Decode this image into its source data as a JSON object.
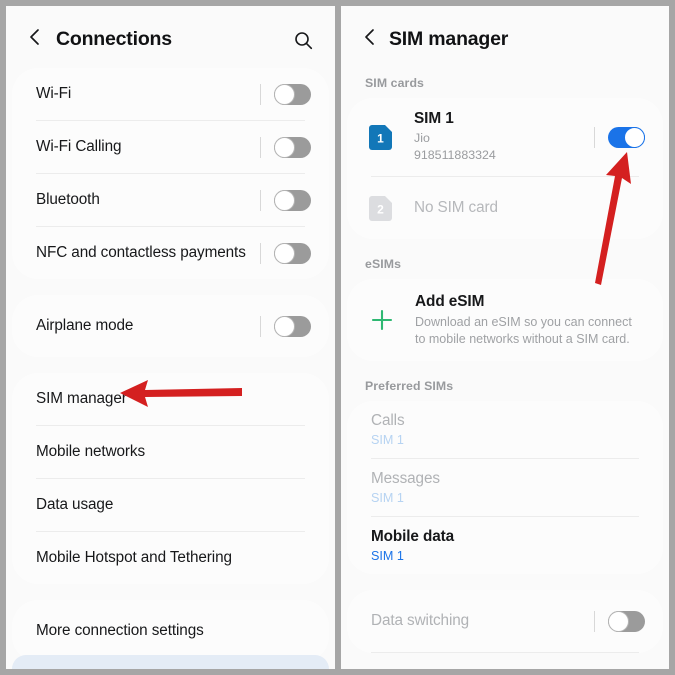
{
  "theme": {
    "accent_blue": "#1a73e8",
    "accent_green": "#2eb872",
    "annotation_red": "#d42020",
    "page_bg": "#fafafa",
    "card_bg": "#fcfcfc",
    "gutter_gray": "#a6a6a6"
  },
  "left_panel": {
    "header": {
      "back_icon": "chevron-left-icon",
      "title": "Connections",
      "search_icon": "search-icon"
    },
    "group_1": [
      {
        "label": "Wi-Fi",
        "toggle": "off"
      },
      {
        "label": "Wi-Fi Calling",
        "toggle": "off"
      },
      {
        "label": "Bluetooth",
        "toggle": "off"
      },
      {
        "label": "NFC and contactless payments",
        "toggle": "off"
      }
    ],
    "group_2": [
      {
        "label": "Airplane mode",
        "toggle": "off"
      }
    ],
    "group_3": [
      {
        "label": "SIM manager"
      },
      {
        "label": "Mobile networks"
      },
      {
        "label": "Data usage"
      },
      {
        "label": "Mobile Hotspot and Tethering"
      }
    ],
    "group_4": [
      {
        "label": "More connection settings"
      }
    ]
  },
  "right_panel": {
    "header": {
      "back_icon": "chevron-left-icon",
      "title": "SIM manager"
    },
    "sim_cards": {
      "section_label": "SIM cards",
      "slots": [
        {
          "badge": "1",
          "title": "SIM 1",
          "carrier": "Jio",
          "number": "918511883324",
          "toggle": "on",
          "enabled": true
        },
        {
          "badge": "2",
          "title": "No SIM card",
          "enabled": false
        }
      ]
    },
    "esims": {
      "section_label": "eSIMs",
      "add_icon": "plus-icon",
      "add_title": "Add eSIM",
      "add_description": "Download an eSIM so you can connect to mobile networks without a SIM card."
    },
    "preferred_sims": {
      "section_label": "Preferred SIMs",
      "items": [
        {
          "label": "Calls",
          "value": "SIM 1",
          "dim": true
        },
        {
          "label": "Messages",
          "value": "SIM 1",
          "dim": true
        },
        {
          "label": "Mobile data",
          "value": "SIM 1",
          "dim": false
        }
      ]
    },
    "data_switching": {
      "label": "Data switching",
      "toggle": "off"
    }
  },
  "annotations": [
    {
      "name": "arrow-pointing-to-sim-manager",
      "direction": "left"
    },
    {
      "name": "arrow-pointing-to-sim1-toggle",
      "direction": "up"
    }
  ]
}
